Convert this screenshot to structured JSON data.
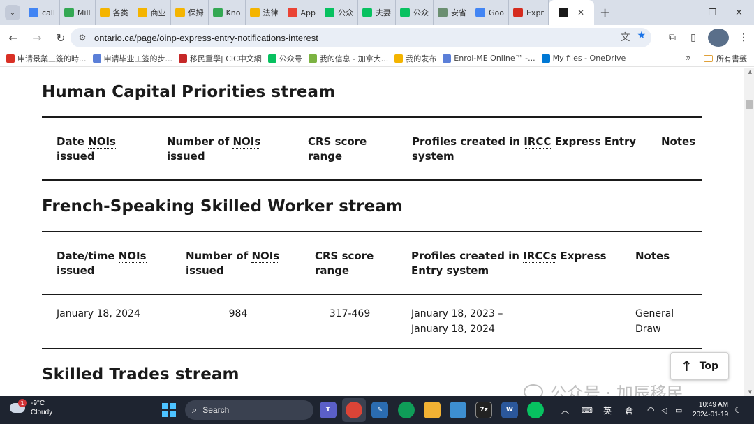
{
  "browser": {
    "tabs": [
      {
        "label": "call",
        "icon": "docs-icon",
        "color": "#4285f4"
      },
      {
        "label": "Mill",
        "icon": "maps-icon",
        "color": "#34a853"
      },
      {
        "label": "各类",
        "icon": "51-icon",
        "color": "#f4b400"
      },
      {
        "label": "商业",
        "icon": "51-icon",
        "color": "#f4b400"
      },
      {
        "label": "保姆",
        "icon": "51-icon",
        "color": "#f4b400"
      },
      {
        "label": "Kno",
        "icon": "maps-icon",
        "color": "#34a853"
      },
      {
        "label": "法律",
        "icon": "51-icon",
        "color": "#f4b400"
      },
      {
        "label": "App",
        "icon": "gmail-icon",
        "color": "#ea4335"
      },
      {
        "label": "公众",
        "icon": "wechat-mp-icon",
        "color": "#07c160"
      },
      {
        "label": "夫妻",
        "icon": "wechat-icon",
        "color": "#07c160"
      },
      {
        "label": "公众",
        "icon": "wechat-mp-icon",
        "color": "#07c160"
      },
      {
        "label": "安省",
        "icon": "chatgpt-icon",
        "color": "#6b8f71"
      },
      {
        "label": "Goo",
        "icon": "translate-icon",
        "color": "#4285f4"
      },
      {
        "label": "Expr",
        "icon": "maple-leaf-icon",
        "color": "#d52b1e"
      },
      {
        "label": "",
        "icon": "ontario-icon",
        "color": "#1a1a1a"
      }
    ],
    "url": "ontario.ca/page/oinp-express-entry-notifications-interest",
    "bookmarks": [
      {
        "label": "申请景業工簽的時...",
        "color": "#d93025"
      },
      {
        "label": "申请毕业工签的步...",
        "color": "#5b7fd8"
      },
      {
        "label": "移民重學| CIC中文網",
        "color": "#c62828"
      },
      {
        "label": "公众号",
        "color": "#07c160"
      },
      {
        "label": "我的信息 - 加拿大...",
        "color": "#7cb342"
      },
      {
        "label": "我的发布",
        "color": "#f4b400"
      },
      {
        "label": "Enrol-ME Online™ -...",
        "color": "#5b7fd8"
      },
      {
        "label": "My files - OneDrive",
        "color": "#0078d4"
      }
    ],
    "bookmarks_more": "»",
    "all_bookmarks": "所有書籤"
  },
  "page": {
    "sections": [
      {
        "title": "Human Capital Priorities stream",
        "headers": [
          {
            "pre": "Date ",
            "abbr": "NOIs",
            "post": "\nissued"
          },
          {
            "pre": "Number of ",
            "abbr": "NOIs",
            "post": "\nissued"
          },
          {
            "pre": "CRS score\nrange",
            "abbr": "",
            "post": ""
          },
          {
            "pre": "Profiles created in ",
            "abbr": "IRCC",
            "post": " Express Entry\nsystem"
          },
          {
            "pre": "Notes",
            "abbr": "",
            "post": ""
          }
        ],
        "rows": []
      },
      {
        "title": "French-Speaking Skilled Worker stream",
        "headers": [
          {
            "pre": "Date/time ",
            "abbr": "NOIs",
            "post": "\nissued"
          },
          {
            "pre": "Number of ",
            "abbr": "NOIs",
            "post": "\nissued"
          },
          {
            "pre": "CRS score\nrange",
            "abbr": "",
            "post": ""
          },
          {
            "pre": "Profiles created in ",
            "abbr": "IRCCs",
            "post": " Express\nEntry system"
          },
          {
            "pre": "Notes",
            "abbr": "",
            "post": ""
          }
        ],
        "rows": [
          [
            "January 18, 2024",
            "984",
            "317-469",
            "January 18, 2023 –\nJanuary 18, 2024",
            "General\nDraw"
          ]
        ]
      },
      {
        "title": "Skilled Trades stream",
        "headers": [],
        "rows": []
      }
    ],
    "top_button": "Top",
    "watermark": "公众号 · 加辰移民"
  },
  "taskbar": {
    "weather_temp": "-9°C",
    "weather_desc": "Cloudy",
    "weather_badge": "1",
    "search_placeholder": "Search",
    "ime": "英",
    "ime2": "倉",
    "time": "10:49 AM",
    "date": "2024-01-19"
  }
}
